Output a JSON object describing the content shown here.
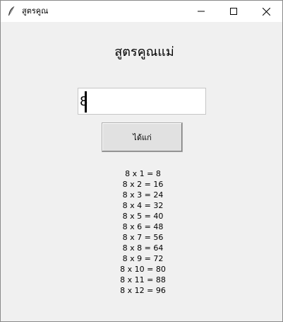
{
  "window": {
    "title": "สูตรคูณ",
    "icon": "feather-icon"
  },
  "controls": {
    "minimize_icon": "minimize-icon",
    "maximize_icon": "maximize-icon",
    "close_icon": "close-icon"
  },
  "main": {
    "heading": "สูตรคูณแม่",
    "input_value": "8",
    "button_label": "ได้แก่",
    "results": [
      "8 x 1 = 8",
      "8 x 2 = 16",
      "8 x 3 = 24",
      "8 x 4 = 32",
      "8 x 5 = 40",
      "8 x 6 = 48",
      "8 x 7 = 56",
      "8 x 8 = 64",
      "8 x 9 = 72",
      "8 x 10 = 80",
      "8 x 11 = 88",
      "8 x 12 = 96"
    ]
  },
  "colors": {
    "window_bg": "#f0f0f0",
    "titlebar_bg": "#ffffff",
    "button_bg": "#e1e1e1",
    "input_bg": "#ffffff"
  }
}
